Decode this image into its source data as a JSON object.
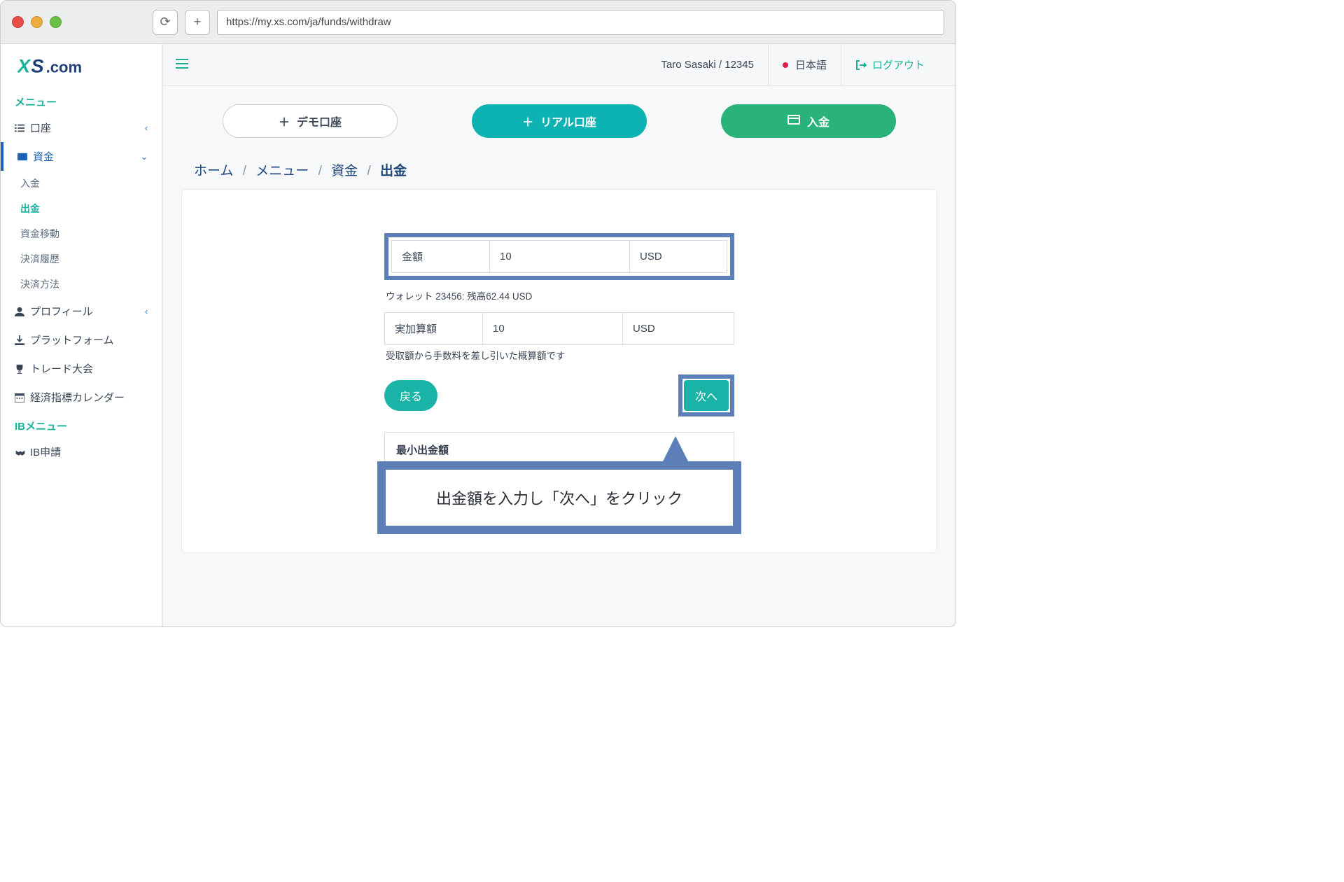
{
  "browser": {
    "url": "https://my.xs.com/ja/funds/withdraw"
  },
  "header": {
    "user_label": "Taro Sasaki / 12345",
    "language_label": "日本語",
    "logout_label": "ログアウト"
  },
  "sidebar": {
    "section_menu": "メニュー",
    "section_ib": "IBメニュー",
    "items": {
      "account": "口座",
      "funds": "資金",
      "profile": "プロフィール",
      "platforms": "プラットフォーム",
      "contest": "トレード大会",
      "calendar": "経済指標カレンダー",
      "ib_apply": "IB申請"
    },
    "funds_sub": {
      "deposit": "入金",
      "withdraw": "出金",
      "transfer": "資金移動",
      "history": "決済履歴",
      "methods": "決済方法"
    }
  },
  "actions": {
    "demo": "デモ口座",
    "real": "リアル口座",
    "deposit": "入金"
  },
  "breadcrumbs": {
    "home": "ホーム",
    "menu": "メニュー",
    "funds": "資金",
    "current": "出金"
  },
  "form": {
    "amount_label": "金額",
    "amount_value": "10",
    "amount_unit": "USD",
    "wallet_hint": "ウォレット 23456: 残高62.44 USD",
    "net_label": "実加算額",
    "net_value": "10",
    "net_unit": "USD",
    "net_hint": "受取額から手数料を差し引いた概算額です",
    "back": "戻る",
    "next": "次へ",
    "min_title": "最小出金額"
  },
  "callout": "出金額を入力し「次へ」をクリック"
}
